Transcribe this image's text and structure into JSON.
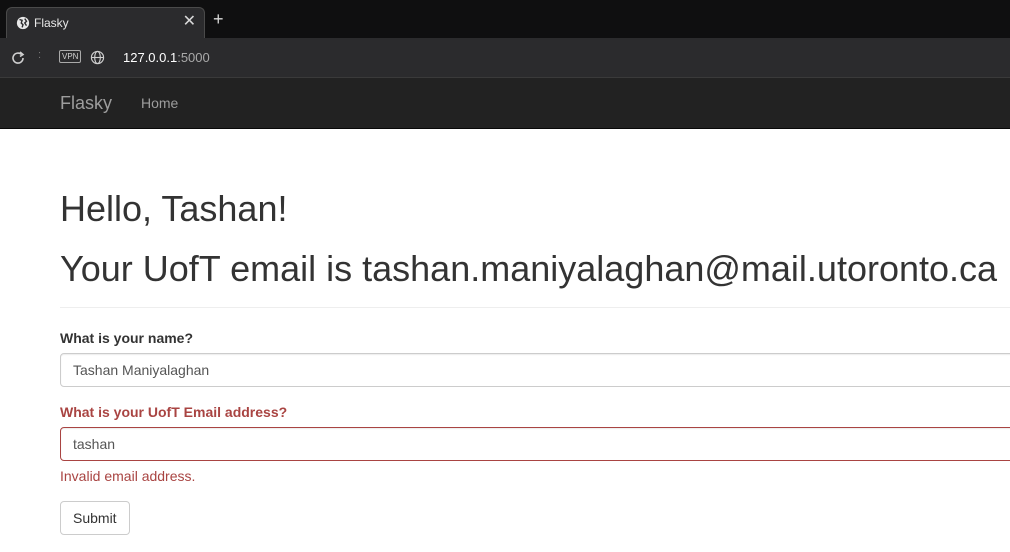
{
  "browser": {
    "tab_title": "Flasky",
    "close_glyph": "✕",
    "new_tab_glyph": "+",
    "separator": ":",
    "vpn_badge": "VPN",
    "url_host": "127.0.0.1",
    "url_port": ":5000"
  },
  "navbar": {
    "brand": "Flasky",
    "links": [
      {
        "label": "Home"
      }
    ]
  },
  "main": {
    "greeting": "Hello, Tashan!",
    "email_line": "Your UofT email is tashan.maniyalaghan@mail.utoronto.ca"
  },
  "form": {
    "name_label": "What is your name?",
    "name_value": "Tashan Maniyalaghan",
    "email_label": "What is your UofT Email address?",
    "email_value": "tashan",
    "email_error": "Invalid email address.",
    "submit_label": "Submit"
  },
  "colors": {
    "navbar_bg": "#222222",
    "error": "#a94442",
    "text": "#333333"
  }
}
